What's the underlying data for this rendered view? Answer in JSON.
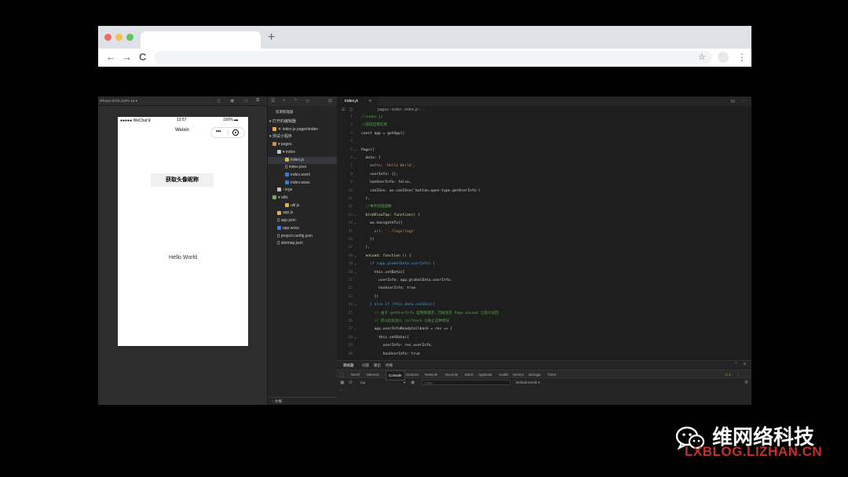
{
  "browser": {
    "new_tab_glyph": "+",
    "back_glyph": "←",
    "forward_glyph": "→",
    "reload_glyph": "C",
    "star_glyph": "☆",
    "menu_glyph": "⋮"
  },
  "simulator": {
    "device_label": "iPhone 6/7/8 100% 16 ▾",
    "status": {
      "carrier": "●●●●● WeChat令",
      "time": "13:57",
      "battery": "100% ▬"
    },
    "nav_title": "Weixin",
    "capsule_dots": "•••",
    "button_label": "获取头像昵称",
    "hello_text": "Hello World"
  },
  "explorer": {
    "header": "资源管理器",
    "sections": [
      {
        "label": "▾ 打开的编辑器",
        "indent": 2,
        "icon": "",
        "icon_color": ""
      },
      {
        "label": "✕  index.js  pages\\index",
        "indent": 6,
        "icon": "js",
        "icon_color": "#e8b32a"
      },
      {
        "label": "▾ 测试小程序",
        "indent": 2,
        "icon": "",
        "icon_color": ""
      },
      {
        "label": "▾  pages",
        "indent": 6,
        "icon": "folder",
        "icon_color": "#dc8a3c"
      },
      {
        "label": "▾  index",
        "indent": 12,
        "icon": "folder",
        "icon_color": "#c0c0c0"
      },
      {
        "label": "index.js",
        "indent": 22,
        "icon": "js",
        "icon_color": "#e8b32a",
        "selected": true
      },
      {
        "label": "{} index.json",
        "indent": 22,
        "icon": "",
        "icon_color": ""
      },
      {
        "label": "index.wxml",
        "indent": 22,
        "icon": "wxml",
        "icon_color": "#3a7bd5"
      },
      {
        "label": "index.wxss",
        "indent": 22,
        "icon": "wxss",
        "icon_color": "#3a7bd5"
      },
      {
        "label": "›  logs",
        "indent": 12,
        "icon": "folder",
        "icon_color": "#c0c0c0"
      },
      {
        "label": "▾  utils",
        "indent": 6,
        "icon": "folder",
        "icon_color": "#6cb057"
      },
      {
        "label": "util.js",
        "indent": 22,
        "icon": "js",
        "icon_color": "#e8b32a"
      },
      {
        "label": "app.js",
        "indent": 12,
        "icon": "js",
        "icon_color": "#e8b32a"
      },
      {
        "label": "{} app.json",
        "indent": 12,
        "icon": "",
        "icon_color": ""
      },
      {
        "label": "app.wxss",
        "indent": 12,
        "icon": "wxss",
        "icon_color": "#3a7bd5"
      },
      {
        "label": "{} project.config.json",
        "indent": 12,
        "icon": "",
        "icon_color": ""
      },
      {
        "label": "{} sitemap.json",
        "indent": 12,
        "icon": "",
        "icon_color": ""
      }
    ],
    "bottom": "› 大纲"
  },
  "editor": {
    "tab_label": "index.js",
    "tab_close": "✕",
    "breadcrumb": "pages  ›  index  ›   index.js  › ...",
    "lines": [
      {
        "n": "1",
        "t": "//index.js",
        "c": "cm"
      },
      {
        "n": "2",
        "t": "//获取应用实例",
        "c": "cm"
      },
      {
        "n": "3",
        "t": "const app = getApp()",
        "c": "pl"
      },
      {
        "n": "4",
        "t": "",
        "c": "pl"
      },
      {
        "n": "5",
        "t": "Page({",
        "c": "pl"
      },
      {
        "n": "6",
        "t": "  data: {",
        "c": "pl"
      },
      {
        "n": "7",
        "t": "    motto: 'Hello World',",
        "c": "st"
      },
      {
        "n": "8",
        "t": "    userInfo: {},",
        "c": "pl"
      },
      {
        "n": "9",
        "t": "    hasUserInfo: false,",
        "c": "pl"
      },
      {
        "n": "10",
        "t": "    canIUse: wx.canIUse('button.open-type.getUserInfo')",
        "c": "pl"
      },
      {
        "n": "11",
        "t": "  },",
        "c": "pl"
      },
      {
        "n": "12",
        "t": "  //事件处理函数",
        "c": "cm"
      },
      {
        "n": "13",
        "t": "  bindViewTap: function() {",
        "c": "fn"
      },
      {
        "n": "14",
        "t": "    wx.navigateTo({",
        "c": "pl"
      },
      {
        "n": "15",
        "t": "      url: '../logs/logs'",
        "c": "st"
      },
      {
        "n": "16",
        "t": "    })",
        "c": "pl"
      },
      {
        "n": "17",
        "t": "  },",
        "c": "pl"
      },
      {
        "n": "18",
        "t": "  onLoad: function () {",
        "c": "fn"
      },
      {
        "n": "19",
        "t": "    if (app.globalData.userInfo) {",
        "c": "kw"
      },
      {
        "n": "20",
        "t": "      this.setData({",
        "c": "pl"
      },
      {
        "n": "21",
        "t": "        userInfo: app.globalData.userInfo,",
        "c": "pl"
      },
      {
        "n": "22",
        "t": "        hasUserInfo: true",
        "c": "pl"
      },
      {
        "n": "23",
        "t": "      })",
        "c": "pl"
      },
      {
        "n": "24",
        "t": "    } else if (this.data.canIUse){",
        "c": "kw"
      },
      {
        "n": "25",
        "t": "      // 由于 getUserInfo 是网络请求，可能会在 Page.onLoad 之后才返回",
        "c": "cm"
      },
      {
        "n": "26",
        "t": "      // 所以此处加入 callback 以防止这种情况",
        "c": "cm"
      },
      {
        "n": "27",
        "t": "      app.userInfoReadyCallback = res => {",
        "c": "pl"
      },
      {
        "n": "28",
        "t": "        this.setData({",
        "c": "pl"
      },
      {
        "n": "29",
        "t": "          userInfo: res.userInfo,",
        "c": "pl"
      },
      {
        "n": "30",
        "t": "          hasUserInfo: true",
        "c": "pl"
      }
    ]
  },
  "devtools": {
    "top_tabs": [
      "调试器",
      "问题",
      "输出",
      "终端"
    ],
    "panel_tabs": [
      "Wxml",
      "Memory",
      "Console",
      "Sources",
      "Network",
      "Security",
      "Mock",
      "AppData",
      "Audits",
      "Sensor",
      "Storage",
      "Trace"
    ],
    "active_panel": "Console",
    "context_select": "top",
    "filter_placeholder": "Filter",
    "levels_select": "Default levels ▾",
    "warning_count": "⚠ 1",
    "prompt": "›"
  },
  "watermark": {
    "brand": "维网络科技",
    "site": "LXBLOG.LIZHAN.CN"
  }
}
